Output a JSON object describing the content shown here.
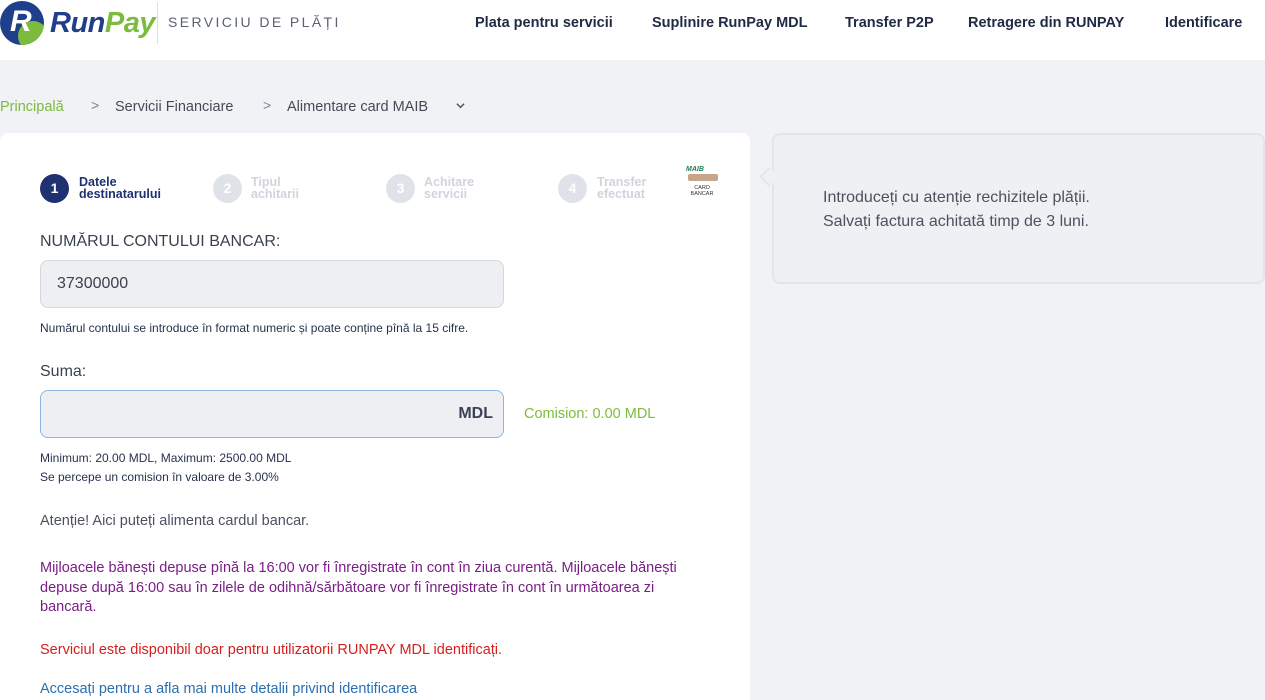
{
  "brand": {
    "name_part1": "Run",
    "name_part2": "Pay",
    "logo_letter": "R",
    "tagline": "SERVICIU DE PLĂȚI",
    "colors": {
      "primary": "#1f3f8a",
      "accent": "#7dbb3d"
    }
  },
  "nav": [
    {
      "label": "Plata pentru servicii"
    },
    {
      "label": "Suplinire RunPay MDL"
    },
    {
      "label": "Transfer P2P"
    },
    {
      "label": "Retragere din RUNPAY"
    },
    {
      "label": "Identificare"
    }
  ],
  "breadcrumb": {
    "home": "Principală",
    "level1": "Servicii Financiare",
    "level2": "Alimentare card MAIB",
    "separator": ">"
  },
  "steps": [
    {
      "number": "1",
      "line1": "Datele",
      "line2": "destinatarului",
      "active": true
    },
    {
      "number": "2",
      "line1": "Tipul",
      "line2": "achitarii",
      "active": false
    },
    {
      "number": "3",
      "line1": "Achitare",
      "line2": "servicii",
      "active": false
    },
    {
      "number": "4",
      "line1": "Transfer",
      "line2": "efectuat",
      "active": false
    }
  ],
  "maib_logo": {
    "top": "MAIB",
    "bottom_line1": "CARD",
    "bottom_line2": "BANCAR"
  },
  "form": {
    "account_label": "NUMĂRUL CONTULUI BANCAR:",
    "account_value": "37300000",
    "account_hint": "Numărul contului se introduce în format numeric și poate conține pînă la 15 cifre.",
    "amount_label": "Suma:",
    "amount_value": "",
    "amount_currency": "MDL",
    "commission": "Comision: 0.00 MDL",
    "limits": "Minimum: 20.00 MDL, Maximum: 2500.00 MDL",
    "fee_note": "Se percepe un comision în valoare de 3.00%"
  },
  "notes": {
    "attention": "Atenție! Aici puteți alimenta cardul bancar.",
    "processing": "Mijloacele bănești depuse pînă la 16:00 vor fi înregistrate în cont în ziua curentă. Mijloacele bănești depuse după 16:00 sau în zilele de odihnă/sărbătoare vor fi înregistrate în cont în următoarea zi bancară.",
    "identified_only": "Serviciul este disponibil doar pentru utilizatorii RUNPAY MDL identificați.",
    "identification_link": "Accesați pentru a afla mai multe detalii privind identificarea"
  },
  "info_panel": {
    "line1": "Introduceți cu atenție rechizitele plății.",
    "line2": "Salvați factura achitată timp de 3 luni."
  }
}
